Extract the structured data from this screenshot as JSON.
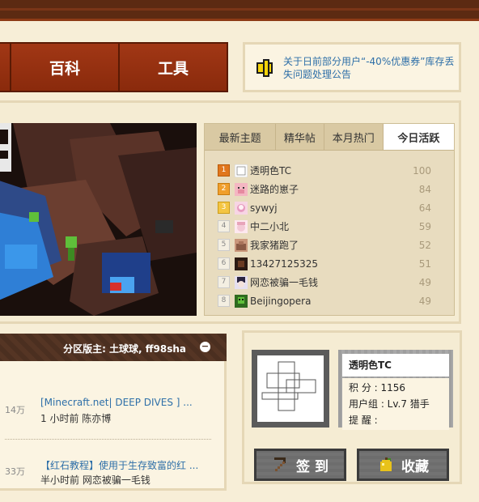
{
  "nav": {
    "items": [
      {
        "label": "百科"
      },
      {
        "label": "工具"
      }
    ]
  },
  "announcement": {
    "text": "关于日前部分用户“-40%优惠券”库存丢失问题处理公告"
  },
  "hot": {
    "tabs": [
      {
        "label": "最新主题"
      },
      {
        "label": "精华帖"
      },
      {
        "label": "本月热门"
      },
      {
        "label": "今日活跃"
      }
    ],
    "active_tab": "今日活跃",
    "ranks": [
      {
        "num": "1",
        "name": "透明色TC",
        "score": "100"
      },
      {
        "num": "2",
        "name": "迷路的崽子",
        "score": "84"
      },
      {
        "num": "3",
        "name": "sywyj",
        "score": "64"
      },
      {
        "num": "4",
        "name": "中二小北",
        "score": "59"
      },
      {
        "num": "5",
        "name": "我家猪跑了",
        "score": "52"
      },
      {
        "num": "6",
        "name": "13427125325",
        "score": "51"
      },
      {
        "num": "7",
        "name": "网恋被骗一毛钱",
        "score": "49"
      },
      {
        "num": "8",
        "name": "Beijingopera",
        "score": "49"
      }
    ]
  },
  "forum": {
    "moderators": "分区版主: 土球球, ff98sha",
    "collapse_symbol": "−",
    "threads": [
      {
        "count": "14万",
        "title": "[Minecraft.net| DEEP DIVES ] ...",
        "meta": "1 小时前 陈亦博"
      },
      {
        "count": "33万",
        "title": "【红石教程】使用于生存致富的红 ...",
        "meta": "半小时前 网恋被骗一毛钱"
      }
    ]
  },
  "user": {
    "name": "透明色TC",
    "points": "积  分 : 1156",
    "group": "用户组 : Lv.7 猎手",
    "remind": "提  醒 :"
  },
  "buttons": {
    "checkin": "签 到",
    "favorite": "收藏"
  }
}
